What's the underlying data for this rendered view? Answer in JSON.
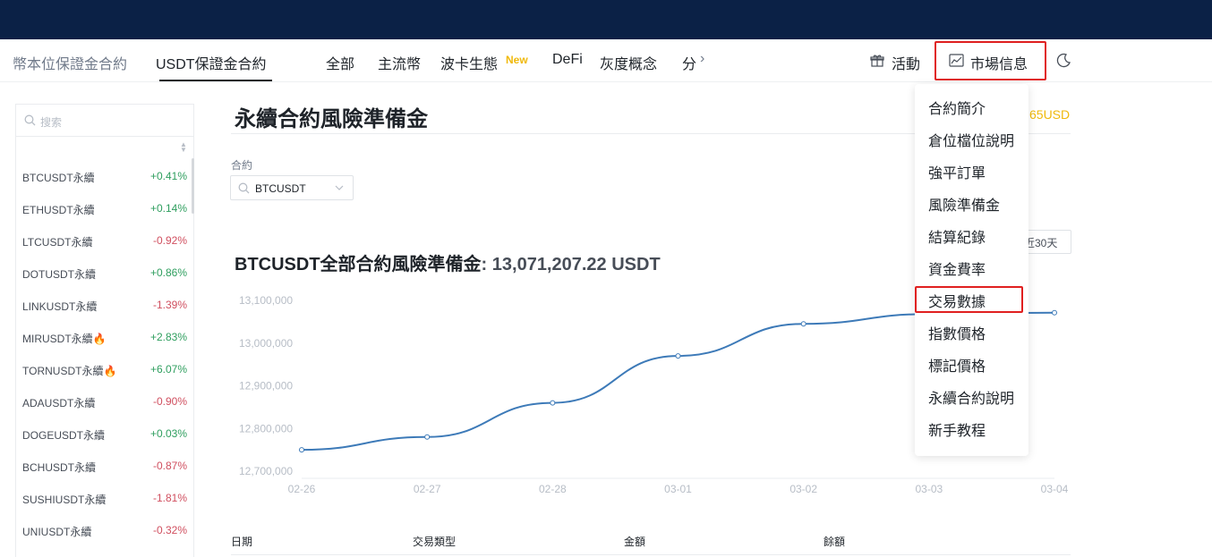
{
  "nav": {
    "tabs": [
      {
        "label": "幣本位保證金合約",
        "active": false
      },
      {
        "label": "USDT保證金合約",
        "active": true
      }
    ],
    "categories": [
      "全部",
      "主流幣",
      "波卡生態",
      "DeFi",
      "灰度概念",
      "分"
    ],
    "new_badge": "New",
    "activity_label": "活動",
    "market_info_label": "市場信息"
  },
  "sidebar": {
    "search_placeholder": "搜索",
    "items": [
      {
        "symbol": "BTCUSDT永續",
        "change": "+0.41%",
        "dir": "up"
      },
      {
        "symbol": "ETHUSDT永續",
        "change": "+0.14%",
        "dir": "up"
      },
      {
        "symbol": "LTCUSDT永續",
        "change": "-0.92%",
        "dir": "down"
      },
      {
        "symbol": "DOTUSDT永續",
        "change": "+0.86%",
        "dir": "up"
      },
      {
        "symbol": "LINKUSDT永續",
        "change": "-1.39%",
        "dir": "down"
      },
      {
        "symbol": "MIRUSDT永續🔥",
        "change": "+2.83%",
        "dir": "up"
      },
      {
        "symbol": "TORNUSDT永續🔥",
        "change": "+6.07%",
        "dir": "up"
      },
      {
        "symbol": "ADAUSDT永續",
        "change": "-0.90%",
        "dir": "down"
      },
      {
        "symbol": "DOGEUSDT永續",
        "change": "+0.03%",
        "dir": "up"
      },
      {
        "symbol": "BCHUSDT永續",
        "change": "-0.87%",
        "dir": "down"
      },
      {
        "symbol": "SUSHIUSDT永續",
        "change": "-1.81%",
        "dir": "down"
      },
      {
        "symbol": "UNIUSDT永續",
        "change": "-0.32%",
        "dir": "down"
      }
    ]
  },
  "main": {
    "title": "永續合約風險準備金",
    "right_amount": "65USD",
    "contract_label": "合約",
    "contract_value": "BTCUSDT",
    "range_label": "近30天",
    "chart_title_prefix": "BTCUSDT全部合約風險準備金",
    "chart_title_value": ": 13,071,207.22 USDT",
    "table_headers": [
      "日期",
      "交易類型",
      "金額",
      "餘額"
    ]
  },
  "dropdown": {
    "items": [
      "合約簡介",
      "倉位檔位說明",
      "強平訂單",
      "風險準備金",
      "結算紀錄",
      "資金費率",
      "交易數據",
      "指數價格",
      "標記價格",
      "永續合約說明",
      "新手教程"
    ],
    "highlighted": "交易數據"
  },
  "colors": {
    "topbar": "#0b2146",
    "line": "#3d7ab8",
    "highlight_border": "#e02020",
    "accent": "#f0b90b"
  },
  "chart_data": {
    "type": "line",
    "x": [
      "02-26",
      "02-27",
      "02-28",
      "03-01",
      "03-02",
      "03-03",
      "03-04"
    ],
    "series": [
      {
        "values": [
          12750000,
          12780000,
          12860000,
          12970000,
          13045000,
          13068000,
          13071207
        ]
      }
    ],
    "y_ticks": [
      "13,100,000",
      "13,000,000",
      "12,900,000",
      "12,800,000",
      "12,700,000"
    ],
    "ylim": [
      12700000,
      13100000
    ],
    "grid": false
  }
}
